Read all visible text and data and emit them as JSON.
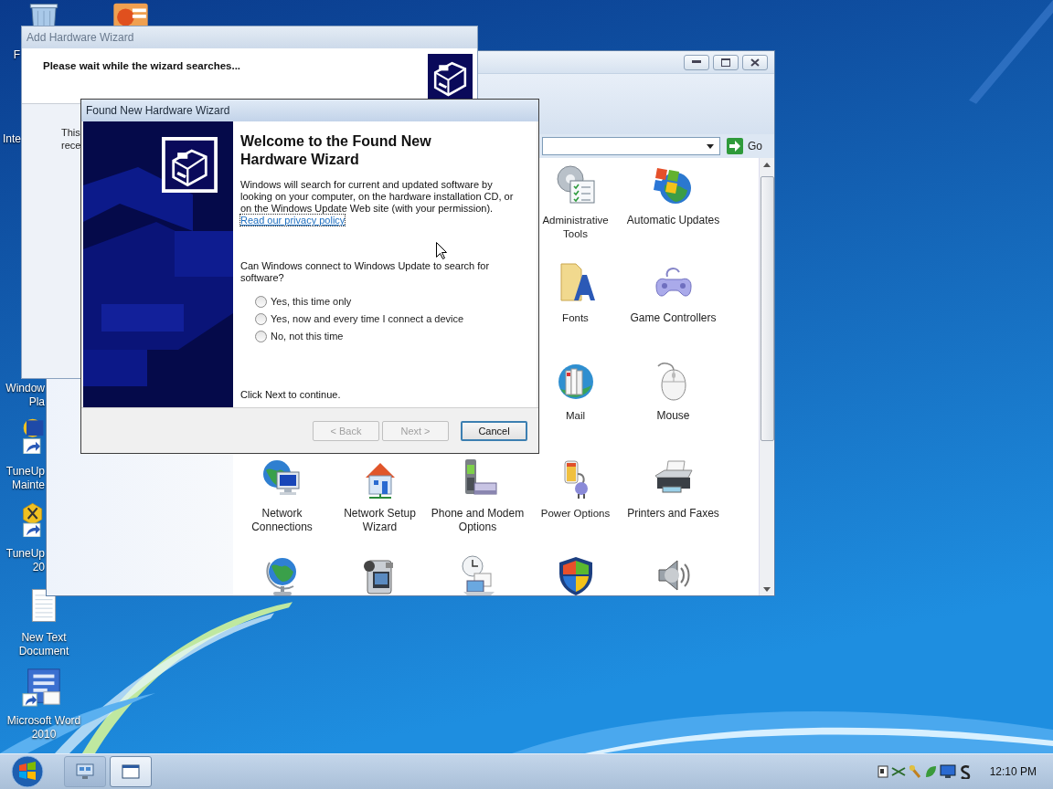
{
  "desktop_icons": [
    {
      "kind": "bin",
      "lines": [
        "F"
      ]
    },
    {
      "kind": "slides"
    },
    {
      "lines": [
        "Inte"
      ]
    },
    {
      "lines": [
        "Window",
        "Pla"
      ]
    },
    {
      "kind": "tuneup",
      "lines": [
        "TuneUp",
        "Mainte"
      ]
    },
    {
      "kind": "tools",
      "lines": [
        "TuneUp",
        "20"
      ]
    },
    {
      "kind": "text",
      "lines": [
        "New Text",
        "Document"
      ]
    },
    {
      "kind": "word",
      "lines": [
        "Microsoft Word",
        "2010"
      ]
    }
  ],
  "control_panel": {
    "go": "Go",
    "rows": [
      {
        "items": [
          {
            "kind": "admin",
            "label": "Administrative Tools"
          },
          {
            "kind": "updates",
            "label": "Automatic Updates"
          }
        ]
      },
      {
        "items": [
          {
            "kind": "fonts",
            "label": "Fonts"
          },
          {
            "kind": "gamepad",
            "label": "Game Controllers"
          }
        ]
      },
      {
        "items": [
          {
            "kind": "mail",
            "label": "Mail"
          },
          {
            "kind": "mouse",
            "label": "Mouse"
          }
        ]
      },
      {
        "items": [
          {
            "kind": "network",
            "label": "Network Connections"
          },
          {
            "kind": "house",
            "label": "Network Setup Wizard"
          },
          {
            "kind": "phone",
            "label": "Phone and Modem Options"
          },
          {
            "kind": "power",
            "label": "Power Options"
          },
          {
            "kind": "printer",
            "label": "Printers and Faxes"
          }
        ]
      },
      {
        "items": [
          {
            "kind": "globe"
          },
          {
            "kind": "camera"
          },
          {
            "kind": "clock"
          },
          {
            "kind": "shield"
          },
          {
            "kind": "speaker"
          }
        ]
      }
    ]
  },
  "add_hardware_wizard": {
    "title": "Add Hardware Wizard",
    "active": false,
    "heading": "Please wait while the wizard searches...",
    "body_lines": [
      "This",
      "rece"
    ]
  },
  "found_new_hardware_wizard": {
    "title": "Found New Hardware Wizard",
    "active": true,
    "heading": "Welcome to the Found New Hardware Wizard",
    "description": "Windows will search for current and updated software by looking on your computer, on the hardware installation CD, or on the Windows Update Web site (with your permission).",
    "link": "Read our privacy policy",
    "question": "Can Windows connect to Windows Update to search for software?",
    "options": [
      {
        "label": "Yes, this time only",
        "selected": false
      },
      {
        "label": "Yes, now and every time I connect a device",
        "selected": false
      },
      {
        "label": "No, not this time",
        "selected": false
      }
    ],
    "footer": "Click Next to continue.",
    "buttons": [
      {
        "label": "< Back",
        "disabled": true,
        "default": false
      },
      {
        "label": "Next >",
        "disabled": true,
        "default": false
      },
      {
        "label": "Cancel",
        "disabled": false,
        "default": true
      }
    ]
  },
  "taskbar": {
    "tasks": [
      {
        "kind": "control-panel",
        "selected": false
      },
      {
        "kind": "window",
        "selected": true
      }
    ],
    "clock": "12:10 PM"
  }
}
